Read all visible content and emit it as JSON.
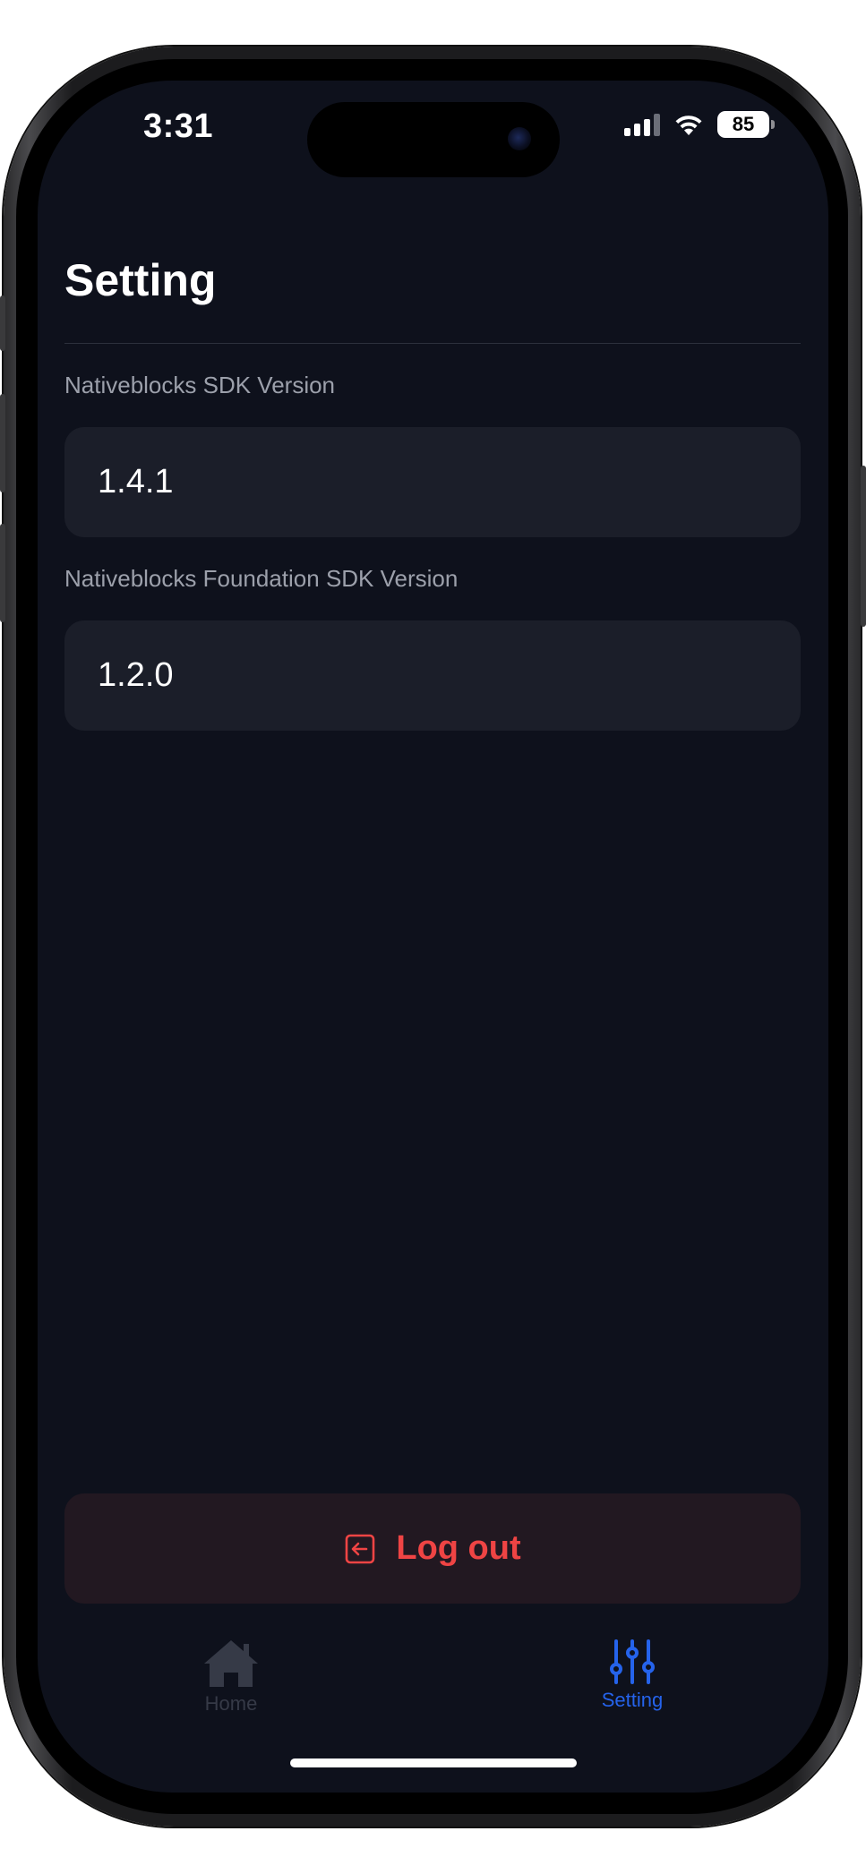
{
  "status_bar": {
    "time": "3:31",
    "battery_level": "85"
  },
  "page": {
    "title": "Setting"
  },
  "fields": [
    {
      "label": "Nativeblocks SDK Version",
      "value": "1.4.1"
    },
    {
      "label": "Nativeblocks Foundation SDK Version",
      "value": "1.2.0"
    }
  ],
  "logout_button": {
    "label": "Log out",
    "icon": "logout-icon",
    "color": "#ef4444"
  },
  "tabbar": {
    "items": [
      {
        "label": "Home",
        "icon": "home-icon",
        "active": false
      },
      {
        "label": "Setting",
        "icon": "sliders-icon",
        "active": true
      }
    ],
    "active_color": "#2563eb",
    "inactive_color": "#363a47"
  },
  "colors": {
    "background": "#0e111c",
    "field_background": "#1b1e29",
    "logout_background": "#221821"
  }
}
